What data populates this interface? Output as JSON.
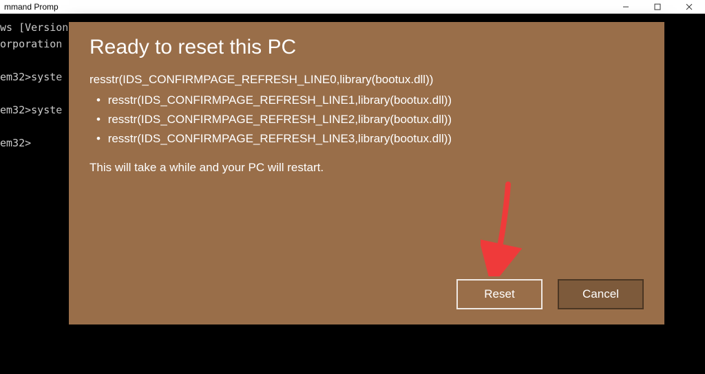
{
  "titlebar": {
    "title": "mmand Promp"
  },
  "console": {
    "lines": "ws [Version\norporation\n\nem32>syste\n\nem32>syste\n\nem32>"
  },
  "modal": {
    "heading": "Ready to reset this PC",
    "line0": "resstr(IDS_CONFIRMPAGE_REFRESH_LINE0,library(bootux.dll))",
    "bullets": [
      "resstr(IDS_CONFIRMPAGE_REFRESH_LINE1,library(bootux.dll))",
      "resstr(IDS_CONFIRMPAGE_REFRESH_LINE2,library(bootux.dll))",
      "resstr(IDS_CONFIRMPAGE_REFRESH_LINE3,library(bootux.dll))"
    ],
    "note": "This will take a while and your PC will restart.",
    "buttons": {
      "reset": "Reset",
      "cancel": "Cancel"
    }
  },
  "colors": {
    "modal_bg": "#996e49",
    "arrow": "#ef3a3a"
  }
}
